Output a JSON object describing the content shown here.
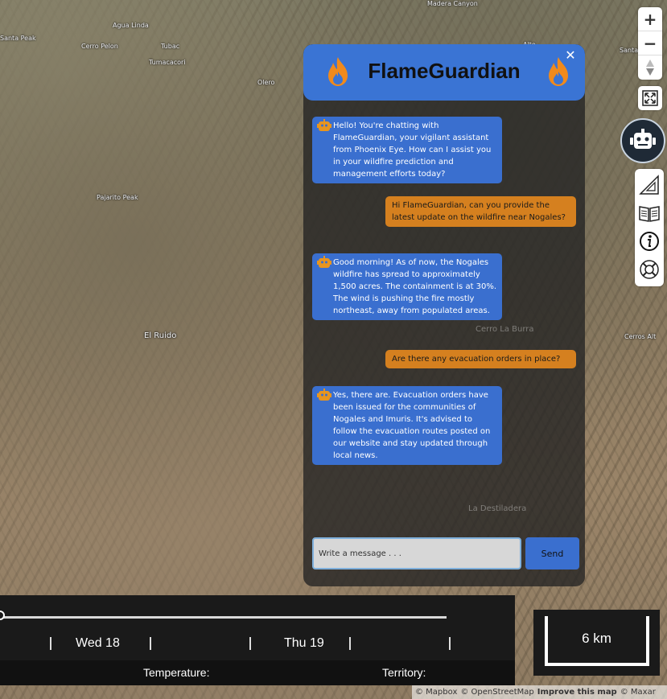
{
  "map": {
    "places": {
      "madera_canyon": "Madera Canyon",
      "agua_linda": "Agua Linda",
      "santa_peak": "Santa Peak",
      "cerro_pelon": "Cerro Pelon",
      "tubac": "Tubac",
      "tumacacori": "Tumacacori",
      "olero": "Olero",
      "pajarito_peak": "Pajarito Peak",
      "el_ruido": "El Ruido",
      "cerro_la_burra": "Cerro La Burra",
      "cerro_alto_right": "Cerros Alt",
      "la_destiladera": "La Destiladera",
      "alto": "Alto",
      "santa_right": "Santa"
    },
    "attribution": {
      "mapbox": "© Mapbox",
      "osm": "© OpenStreetMap",
      "improve": "Improve this map",
      "maxar": "© Maxar"
    }
  },
  "controls": {
    "zoom_in": "+",
    "zoom_out": "−"
  },
  "chat": {
    "title": "FlameGuardian",
    "close": "✕",
    "messages": [
      {
        "role": "bot",
        "text": "Hello! You're chatting with FlameGuardian, your vigilant assistant from Phoenix Eye. How can I assist you in your wildfire prediction and management efforts today?"
      },
      {
        "role": "user",
        "text": "Hi FlameGuardian, can you provide the latest update on the wildfire near Nogales?"
      },
      {
        "role": "bot",
        "text": "Good morning! As of now, the Nogales wildfire has spread to approximately 1,500 acres. The containment is at 30%. The wind is pushing the fire mostly northeast, away from populated areas."
      },
      {
        "role": "user",
        "text": "Are there any evacuation orders in place?"
      },
      {
        "role": "bot",
        "text": "Yes, there are. Evacuation orders have been issued for the communities of Nogales and Imuris. It's advised to follow the evacuation routes posted on our website and stay updated through local news."
      }
    ],
    "input_placeholder": "Write a message . . .",
    "send_label": "Send"
  },
  "timeline": {
    "days": [
      "Wed 18",
      "Thu 19"
    ],
    "temperature_label": "Temperature:",
    "territory_label": "Territory:",
    "slider_position": 0
  },
  "scale": {
    "label": "6 km"
  },
  "colors": {
    "chat_header": "#3a74d4",
    "bot_bubble": "#3a6fcf",
    "user_bubble": "#d5801f",
    "flame": "#f08a1c"
  }
}
